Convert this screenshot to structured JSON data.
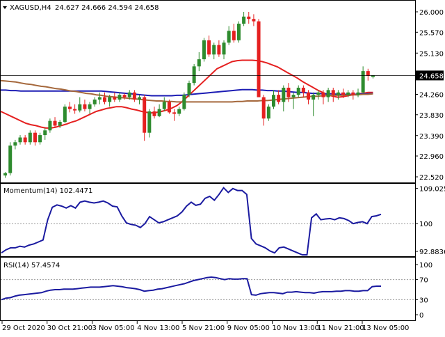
{
  "chart_data": [
    {
      "type": "candlestick",
      "header": {
        "symbol": "XAGUSD,H4",
        "ohlc": "24.627 24.666 24.594 24.658"
      },
      "ylim": [
        22.52,
        26.0
      ],
      "y_ticks": [
        "26.000",
        "25.570",
        "25.130",
        "24.260",
        "23.830",
        "23.390",
        "22.960",
        "22.520"
      ],
      "current_price": 24.658,
      "current_price_label": "24.658",
      "x_ticks": [
        "29 Oct 2020",
        "30 Oct 21:00",
        "3 Nov 05:00",
        "4 Nov 13:00",
        "5 Nov 21:00",
        "9 Nov 05:00",
        "10 Nov 13:00",
        "11 Nov 21:00",
        "13 Nov 05:00"
      ],
      "candles": [
        [
          22.55,
          22.62,
          22.5,
          22.6
        ],
        [
          22.6,
          23.25,
          22.55,
          23.18
        ],
        [
          23.18,
          23.3,
          23.1,
          23.25
        ],
        [
          23.25,
          23.4,
          23.2,
          23.35
        ],
        [
          23.35,
          23.4,
          23.2,
          23.25
        ],
        [
          23.25,
          23.5,
          23.2,
          23.45
        ],
        [
          23.45,
          23.5,
          23.18,
          23.25
        ],
        [
          23.25,
          23.45,
          23.2,
          23.4
        ],
        [
          23.4,
          23.55,
          23.3,
          23.5
        ],
        [
          23.5,
          23.75,
          23.45,
          23.7
        ],
        [
          23.7,
          23.78,
          23.55,
          23.6
        ],
        [
          23.6,
          23.72,
          23.55,
          23.68
        ],
        [
          23.68,
          24.05,
          23.65,
          24.0
        ],
        [
          24.0,
          24.1,
          23.88,
          23.95
        ],
        [
          23.95,
          24.05,
          23.85,
          23.92
        ],
        [
          23.92,
          24.2,
          23.88,
          24.05
        ],
        [
          24.05,
          24.15,
          23.9,
          23.95
        ],
        [
          23.95,
          24.1,
          23.85,
          24.05
        ],
        [
          24.05,
          24.2,
          24.0,
          24.15
        ],
        [
          24.15,
          24.3,
          24.05,
          24.2
        ],
        [
          24.2,
          24.3,
          24.05,
          24.1
        ],
        [
          24.1,
          24.25,
          24.0,
          24.2
        ],
        [
          24.2,
          24.3,
          24.1,
          24.15
        ],
        [
          24.15,
          24.3,
          24.1,
          24.25
        ],
        [
          24.25,
          24.28,
          24.15,
          24.2
        ],
        [
          24.2,
          24.35,
          24.15,
          24.3
        ],
        [
          24.3,
          24.35,
          24.1,
          24.15
        ],
        [
          24.15,
          24.25,
          24.05,
          24.2
        ],
        [
          24.2,
          24.25,
          23.28,
          23.45
        ],
        [
          23.45,
          23.95,
          23.35,
          23.9
        ],
        [
          23.9,
          24.0,
          23.75,
          23.8
        ],
        [
          23.8,
          24.05,
          23.78,
          23.95
        ],
        [
          23.95,
          24.2,
          23.9,
          24.1
        ],
        [
          24.1,
          24.15,
          23.85,
          23.88
        ],
        [
          23.88,
          23.95,
          23.7,
          23.85
        ],
        [
          23.85,
          24.0,
          23.8,
          23.95
        ],
        [
          23.95,
          24.3,
          23.92,
          24.25
        ],
        [
          24.25,
          24.55,
          24.2,
          24.5
        ],
        [
          24.5,
          24.9,
          24.45,
          24.85
        ],
        [
          24.85,
          25.15,
          24.75,
          25.0
        ],
        [
          25.0,
          25.45,
          24.95,
          25.4
        ],
        [
          25.4,
          25.5,
          25.05,
          25.1
        ],
        [
          25.1,
          25.35,
          25.0,
          25.3
        ],
        [
          25.3,
          25.4,
          25.05,
          25.1
        ],
        [
          25.1,
          25.4,
          25.0,
          25.35
        ],
        [
          25.35,
          25.7,
          25.3,
          25.6
        ],
        [
          25.6,
          25.75,
          25.35,
          25.4
        ],
        [
          25.4,
          25.8,
          25.35,
          25.75
        ],
        [
          25.75,
          26.0,
          25.7,
          25.9
        ],
        [
          25.9,
          26.0,
          25.75,
          25.85
        ],
        [
          25.85,
          25.95,
          25.7,
          25.8
        ],
        [
          25.8,
          25.85,
          24.4,
          24.2
        ],
        [
          24.2,
          24.25,
          23.6,
          23.75
        ],
        [
          23.75,
          24.05,
          23.7,
          24.0
        ],
        [
          24.0,
          24.35,
          23.95,
          24.25
        ],
        [
          24.25,
          24.35,
          24.05,
          24.1
        ],
        [
          24.1,
          24.45,
          23.9,
          24.4
        ],
        [
          24.4,
          24.5,
          24.1,
          24.2
        ],
        [
          24.2,
          24.3,
          23.95,
          24.25
        ],
        [
          24.25,
          24.45,
          24.2,
          24.4
        ],
        [
          24.4,
          24.45,
          24.2,
          24.3
        ],
        [
          24.3,
          24.35,
          24.05,
          24.15
        ],
        [
          24.15,
          24.3,
          23.8,
          24.25
        ],
        [
          24.25,
          24.35,
          24.15,
          24.3
        ],
        [
          24.3,
          24.35,
          24.05,
          24.2
        ],
        [
          24.2,
          24.4,
          24.1,
          24.35
        ],
        [
          24.35,
          24.4,
          24.1,
          24.25
        ],
        [
          24.25,
          24.35,
          24.15,
          24.3
        ],
        [
          24.3,
          24.38,
          24.18,
          24.25
        ],
        [
          24.25,
          24.35,
          24.2,
          24.3
        ],
        [
          24.3,
          24.35,
          24.15,
          24.25
        ],
        [
          24.25,
          24.38,
          24.2,
          24.3
        ],
        [
          24.3,
          24.85,
          24.28,
          24.75
        ],
        [
          24.75,
          24.8,
          24.55,
          24.65
        ],
        [
          24.627,
          24.666,
          24.594,
          24.658
        ]
      ],
      "moving_averages": [
        {
          "color": "#e52020",
          "values": [
            23.9,
            23.85,
            23.8,
            23.75,
            23.7,
            23.65,
            23.62,
            23.6,
            23.57,
            23.55,
            23.55,
            23.57,
            23.6,
            23.63,
            23.67,
            23.7,
            23.75,
            23.8,
            23.85,
            23.9,
            23.93,
            23.96,
            23.98,
            24.0,
            24.0,
            23.98,
            23.95,
            23.93,
            23.9,
            23.88,
            23.87,
            23.88,
            23.9,
            23.93,
            23.97,
            24.02,
            24.1,
            24.2,
            24.3,
            24.4,
            24.5,
            24.6,
            24.7,
            24.8,
            24.85,
            24.9,
            24.95,
            24.97,
            24.98,
            24.98,
            24.98,
            24.97,
            24.95,
            24.92,
            24.88,
            24.84,
            24.78,
            24.72,
            24.66,
            24.6,
            24.53,
            24.47,
            24.41,
            24.35,
            24.3,
            24.25,
            24.22,
            24.2,
            24.21,
            24.23,
            24.25,
            24.27,
            24.28,
            24.3,
            24.3
          ]
        },
        {
          "color": "#1c1cb4",
          "values": [
            24.35,
            24.35,
            24.34,
            24.34,
            24.33,
            24.33,
            24.33,
            24.33,
            24.33,
            24.33,
            24.33,
            24.33,
            24.33,
            24.33,
            24.33,
            24.33,
            24.33,
            24.33,
            24.33,
            24.33,
            24.33,
            24.32,
            24.31,
            24.3,
            24.29,
            24.28,
            24.27,
            24.26,
            24.25,
            24.24,
            24.23,
            24.23,
            24.23,
            24.23,
            24.23,
            24.24,
            24.24,
            24.25,
            24.26,
            24.27,
            24.28,
            24.29,
            24.3,
            24.31,
            24.32,
            24.33,
            24.34,
            24.35,
            24.36,
            24.36,
            24.36,
            24.35,
            24.35,
            24.34,
            24.34,
            24.33,
            24.33,
            24.32,
            24.31,
            24.3,
            24.3,
            24.29,
            24.28,
            24.28,
            24.27,
            24.27,
            24.27,
            24.26,
            24.26,
            24.26,
            24.26,
            24.26,
            24.27,
            24.27,
            24.28
          ]
        },
        {
          "color": "#a5683c",
          "values": [
            24.55,
            24.54,
            24.53,
            24.52,
            24.5,
            24.48,
            24.47,
            24.45,
            24.43,
            24.42,
            24.4,
            24.38,
            24.37,
            24.35,
            24.33,
            24.32,
            24.3,
            24.28,
            24.27,
            24.25,
            24.24,
            24.22,
            24.21,
            24.2,
            24.19,
            24.18,
            24.17,
            24.16,
            24.15,
            24.14,
            24.13,
            24.12,
            24.12,
            24.11,
            24.11,
            24.1,
            24.1,
            24.1,
            24.1,
            24.1,
            24.1,
            24.1,
            24.1,
            24.1,
            24.1,
            24.1,
            24.1,
            24.11,
            24.11,
            24.12,
            24.12,
            24.12,
            24.13,
            24.13,
            24.14,
            24.15,
            24.16,
            24.17,
            24.18,
            24.19,
            24.2,
            24.21,
            24.22,
            24.22,
            24.23,
            24.23,
            24.24,
            24.24,
            24.24,
            24.25,
            24.25,
            24.25,
            24.26,
            24.26,
            24.27
          ]
        }
      ]
    },
    {
      "type": "line",
      "label": "Momentum(14) 102.4471",
      "ylim": [
        92.0,
        109.5
      ],
      "y_ticks": [
        "109.0251",
        "100",
        "92.8836"
      ],
      "reference": 100,
      "series": [
        {
          "color": "#1a1aa0",
          "values": [
            92.5,
            93.3,
            93.8,
            93.8,
            94.2,
            94.0,
            94.5,
            94.8,
            95.3,
            95.8,
            101.0,
            104.2,
            104.8,
            104.5,
            104.0,
            104.6,
            104.0,
            105.5,
            105.8,
            105.5,
            105.3,
            105.5,
            105.8,
            105.3,
            104.5,
            104.3,
            102.0,
            100.2,
            99.8,
            99.6,
            99.0,
            100.0,
            101.8,
            101.0,
            100.2,
            100.5,
            101.0,
            101.5,
            102.0,
            103.0,
            104.5,
            105.5,
            104.7,
            105.0,
            106.5,
            107.0,
            106.0,
            107.5,
            109.2,
            108.0,
            109.0,
            108.5,
            108.5,
            107.5,
            96.2,
            94.8,
            94.3,
            93.8,
            93.0,
            92.5,
            93.8,
            94.0,
            93.5,
            93.0,
            92.5,
            92.0,
            92.0,
            101.5,
            102.5,
            101.0,
            101.2,
            101.3,
            101.0,
            101.5,
            101.3,
            100.8,
            100.0,
            100.3,
            100.5,
            100.0,
            101.8,
            102.0,
            102.4
          ]
        }
      ]
    },
    {
      "type": "line",
      "label": "RSI(14) 57.4574",
      "ylim": [
        0,
        100
      ],
      "y_ticks": [
        "100",
        "70",
        "30",
        "0"
      ],
      "levels": [
        70,
        30
      ],
      "series": [
        {
          "color": "#1a1aa0",
          "values": [
            30,
            33,
            34,
            37,
            39,
            40,
            41,
            42,
            43,
            44,
            47,
            49,
            50,
            50,
            51,
            51,
            51,
            52,
            53,
            54,
            55,
            55,
            55,
            56,
            57,
            58,
            57,
            56,
            54,
            53,
            52,
            50,
            47,
            48,
            49,
            51,
            52,
            54,
            56,
            58,
            60,
            62,
            65,
            68,
            70,
            72,
            74,
            75,
            74,
            72,
            70,
            72,
            71,
            71,
            72,
            72,
            40,
            39,
            42,
            43,
            44,
            44,
            43,
            42,
            45,
            45,
            46,
            45,
            44,
            44,
            43,
            45,
            46,
            46,
            46,
            47,
            47,
            48,
            48,
            47,
            47,
            48,
            48,
            56,
            57,
            57
          ]
        }
      ]
    }
  ]
}
